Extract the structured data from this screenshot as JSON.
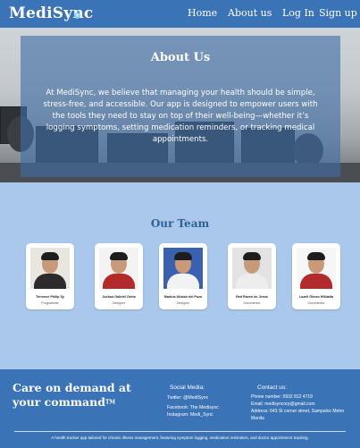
{
  "nav": {
    "logo": "MediSync",
    "logo_mark": "+",
    "links": [
      "Home",
      "About us",
      "Log In",
      "Sign up"
    ]
  },
  "about": {
    "title": "About Us",
    "text": "At MediSync, we believe that managing your health should be simple, stress-free, and accessible. Our app is designed to empower users with the tools they need to stay on top of their well-being—whether it’s logging symptoms, setting medication reminders, or tracking medical appointments."
  },
  "team": {
    "title": "Our Team",
    "members": [
      {
        "name": "Terrence Philip Sy",
        "role": "Programmer",
        "shirt": "#2b2b2b"
      },
      {
        "name": "Joshua Gabriel Greta",
        "role": "Designer",
        "shirt": "#b32a2a"
      },
      {
        "name": "Markus Alistair del Pozo",
        "role": "Designer",
        "shirt": "#f2f2f2"
      },
      {
        "name": "Red Raven de Jesus",
        "role": "Documentor",
        "shirt": "#ededed"
      },
      {
        "name": "Lazell Gimeo Hilldalla",
        "role": "Documentor",
        "shirt": "#b32a2a"
      }
    ]
  },
  "footer": {
    "tagline_line1": "Care on demand at",
    "tagline_line2": "your command",
    "tagline_tm": "TM",
    "social_title": "Social Media:",
    "social_lines": [
      "Twitter: @MediSync",
      "Facebook: The Medisync",
      "Instagram: Medi_Sync"
    ],
    "contact_title": "Contact us:",
    "contact_lines": [
      "Phone number: 0932 812 4719",
      "Email: medisyncorp@gmail.com",
      "Address: 643 St corner street, Sampaloc Metro Manila"
    ],
    "note": "A health tracker app tailored for chronic illness management, featuring symptom logging, medication reminders, and doctor appointment tracking."
  }
}
